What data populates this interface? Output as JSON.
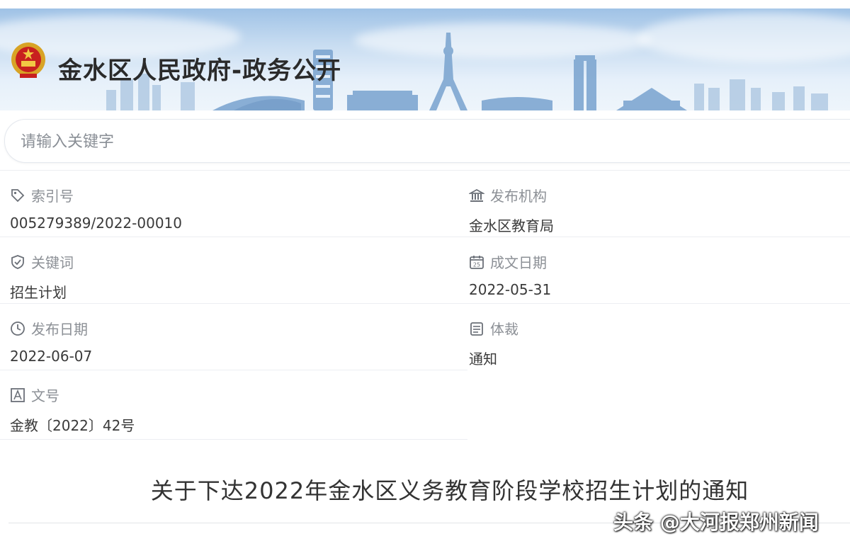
{
  "header": {
    "site_title": "金水区人民政府-政务公开"
  },
  "search": {
    "placeholder": "请输入关键字"
  },
  "info": {
    "index_no": {
      "label": "索引号",
      "value": "005279389/2022-00010",
      "icon": "tag-icon"
    },
    "publisher": {
      "label": "发布机构",
      "value": "金水区教育局",
      "icon": "building-icon"
    },
    "keywords": {
      "label": "关键词",
      "value": "招生计划",
      "icon": "shield-check-icon"
    },
    "written_date": {
      "label": "成文日期",
      "value": "2022-05-31",
      "icon": "calendar-icon"
    },
    "publish_date": {
      "label": "发布日期",
      "value": "2022-06-07",
      "icon": "clock-icon"
    },
    "genre": {
      "label": "体裁",
      "value": "通知",
      "icon": "document-list-icon"
    },
    "doc_number": {
      "label": "文号",
      "value": "金教〔2022〕42号",
      "icon": "text-a-icon"
    }
  },
  "document": {
    "title": "关于下达2022年金水区义务教育阶段学校招生计划的通知"
  },
  "watermark": {
    "text": "头条 @大河报郑州新闻"
  },
  "colors": {
    "banner_top": "#9fc2e6",
    "banner_bottom": "#eef5fb",
    "label": "#8c9096",
    "value": "#3a3a3a"
  }
}
